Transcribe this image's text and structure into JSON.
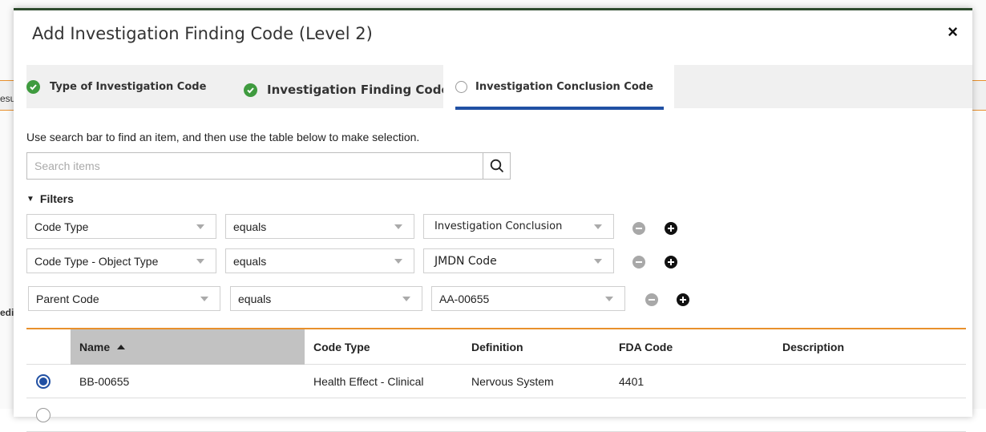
{
  "background": {
    "fragment_results": "esu",
    "fragment_medic": "edic"
  },
  "modal": {
    "title": "Add Investigation Finding Code (Level 2)",
    "close_icon": "close-icon",
    "close_glyph": "×"
  },
  "wizard": {
    "tabs": [
      {
        "label": "Type of Investigation Code",
        "status": "complete",
        "icon": "check-circle-icon"
      },
      {
        "label": "Investigation Finding Code",
        "status": "complete",
        "icon": "check-circle-icon"
      },
      {
        "label": "Investigation Conclusion Code",
        "status": "active",
        "icon": "empty-radio-icon"
      }
    ],
    "active_color": "#2150a3",
    "complete_color": "#3f9b3f"
  },
  "instructions": "Use search bar to find an item, and then use the table below to make selection.",
  "search": {
    "placeholder": "Search items",
    "value": "",
    "icon": "search-icon"
  },
  "filters": {
    "label": "Filters",
    "rows": [
      {
        "field": "Code Type",
        "operator": "equals",
        "value": "Investigation Conclusion"
      },
      {
        "field": "Code Type - Object Type",
        "operator": "equals",
        "value": "JMDN Code"
      },
      {
        "field": "Parent Code",
        "operator": "equals",
        "value": "AA-00655"
      }
    ],
    "remove_icon": "minus-circle-icon",
    "add_icon": "plus-circle-icon"
  },
  "table": {
    "columns": [
      "Name",
      "Code Type",
      "Definition",
      "FDA Code",
      "Description"
    ],
    "sorted_column": "Name",
    "sort_direction": "ascending",
    "rows": [
      {
        "name": "BB-00655",
        "code_type": "Health Effect - Clinical",
        "definition": "Nervous System",
        "fda_code": "4401",
        "description": "",
        "selected": true
      }
    ]
  },
  "colors": {
    "accent_orange": "#e8902c",
    "header_dark_green": "#2d4a2d"
  }
}
